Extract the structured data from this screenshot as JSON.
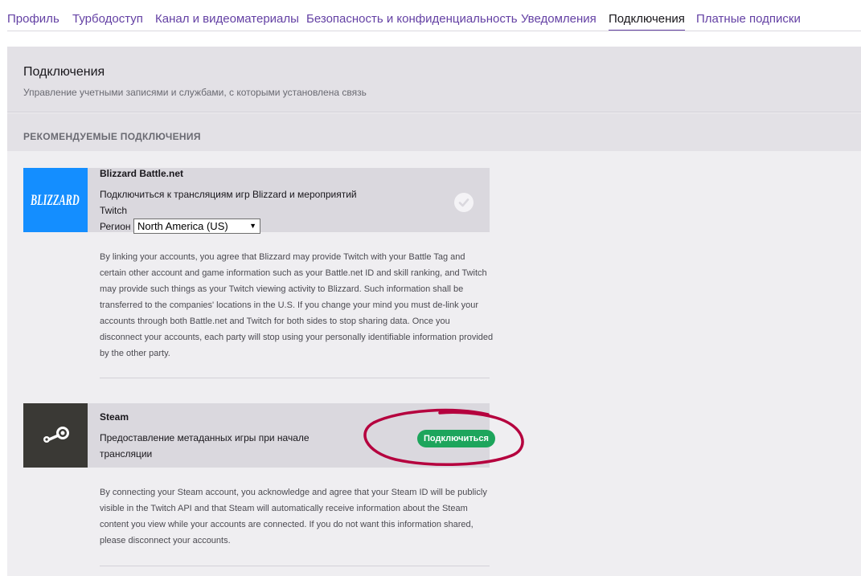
{
  "tabs": [
    {
      "label": "Профиль",
      "active": false
    },
    {
      "label": "Турбодоступ",
      "active": false
    },
    {
      "label": "Канал и видеоматериалы",
      "active": false
    },
    {
      "label": "Безопасность и конфиденциальность",
      "active": false
    },
    {
      "label": "Уведомления",
      "active": false
    },
    {
      "label": "Подключения",
      "active": true
    },
    {
      "label": "Платные подписки",
      "active": false
    }
  ],
  "header": {
    "title": "Подключения",
    "subtitle": "Управление учетными записями и службами, с которыми установлена связь"
  },
  "section": {
    "title": "РЕКОМЕНДУЕМЫЕ ПОДКЛЮЧЕНИЯ"
  },
  "blizzard": {
    "logo_text": "BLIZZARD",
    "name": "Blizzard Battle.net",
    "desc_line1": "Подключиться к трансляциям игр Blizzard и мероприятий",
    "desc_line2": "Twitch",
    "region_label": "Регион",
    "region_value": "North America (US)",
    "status_icon": "check-circle-icon",
    "brand_color": "#148eff",
    "legal": "By linking your accounts, you agree that Blizzard may provide Twitch with your Battle Tag and certain other account and game information such as your Battle.net ID and skill ranking, and Twitch may provide such things as your Twitch viewing activity to Blizzard. Such information shall be transferred to the companies' locations in the U.S. If you change your mind you must de-link your accounts through both Battle.net and Twitch for both sides to stop sharing data. Once you disconnect your accounts, each party will stop using your personally identifiable information provided by the other party."
  },
  "steam": {
    "name": "Steam",
    "desc_line1": "Предоставление метаданных игры при начале",
    "desc_line2": "трансляции",
    "button_label": "Подключиться",
    "logo_icon": "steam-icon",
    "brand_color": "#3a3935",
    "legal": "By connecting your Steam account, you acknowledge and agree that your Steam ID will be publicly visible in the Twitch API and that Steam will automatically receive information about the Steam content you view while your accounts are connected. If you do not want this information shared, please disconnect your accounts."
  },
  "colors": {
    "accent": "#6441a4",
    "connect_button": "#1da55c",
    "annotation": "#b5003e"
  }
}
